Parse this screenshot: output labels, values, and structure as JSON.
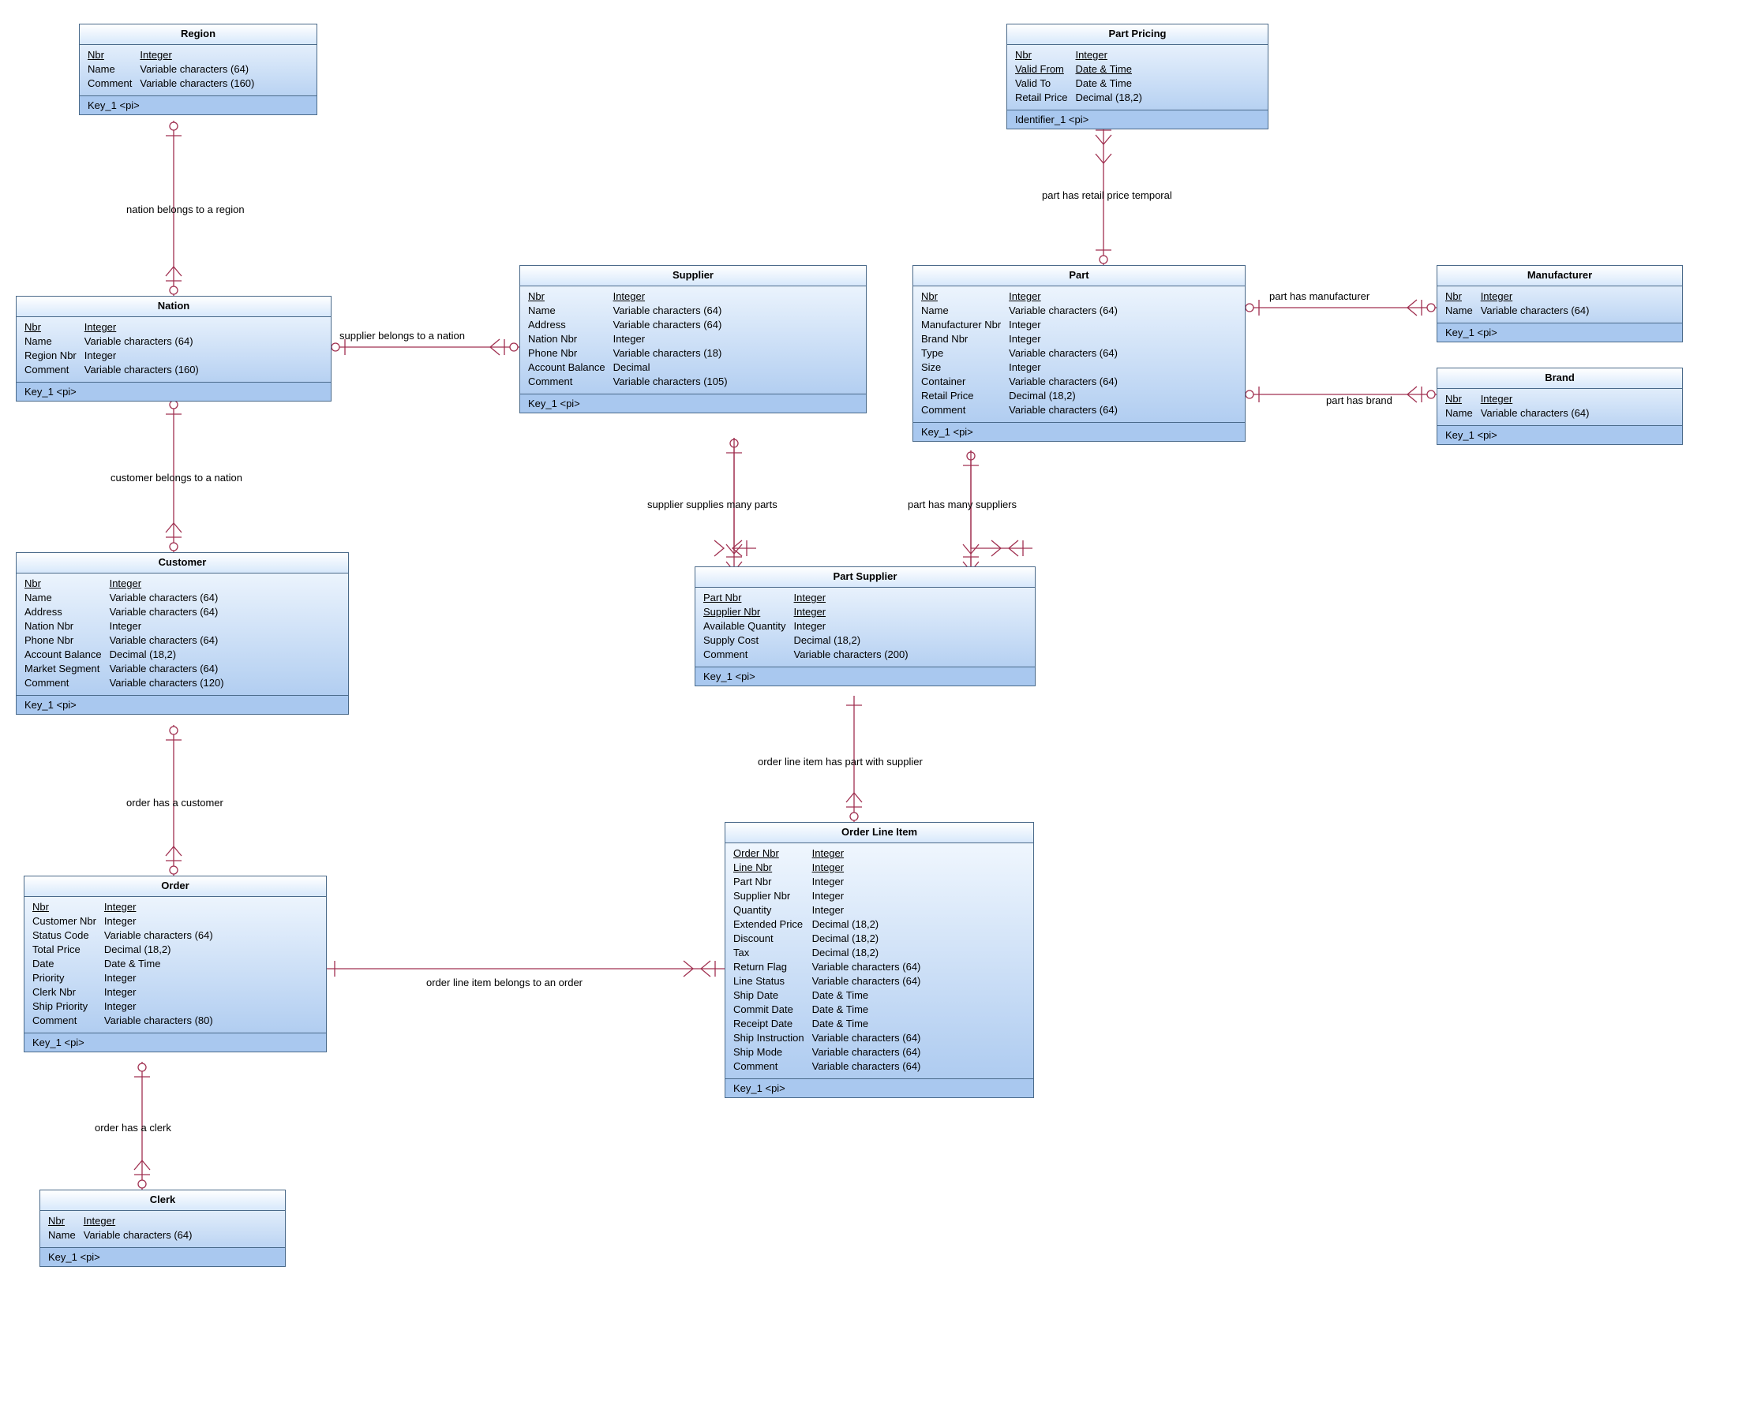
{
  "entities": {
    "region": {
      "title": "Region",
      "attrs": [
        {
          "n": "Nbr",
          "t": "Integer",
          "pk": true
        },
        {
          "n": "Name",
          "t": "Variable characters (64)"
        },
        {
          "n": "Comment",
          "t": "Variable characters (160)"
        }
      ],
      "key": "Key_1   <pi>"
    },
    "nation": {
      "title": "Nation",
      "attrs": [
        {
          "n": "Nbr",
          "t": "Integer",
          "pk": true
        },
        {
          "n": "Name",
          "t": "Variable characters (64)"
        },
        {
          "n": "Region Nbr",
          "t": "Integer"
        },
        {
          "n": "Comment",
          "t": "Variable characters (160)"
        }
      ],
      "key": "Key_1   <pi>"
    },
    "supplier": {
      "title": "Supplier",
      "attrs": [
        {
          "n": "Nbr",
          "t": "Integer",
          "pk": true
        },
        {
          "n": "Name",
          "t": "Variable characters (64)"
        },
        {
          "n": "Address",
          "t": "Variable characters (64)"
        },
        {
          "n": "Nation Nbr",
          "t": "Integer"
        },
        {
          "n": "Phone Nbr",
          "t": "Variable characters (18)"
        },
        {
          "n": "Account Balance",
          "t": "Decimal"
        },
        {
          "n": "Comment",
          "t": "Variable characters (105)"
        }
      ],
      "key": "Key_1   <pi>"
    },
    "customer": {
      "title": "Customer",
      "attrs": [
        {
          "n": "Nbr",
          "t": "Integer",
          "pk": true
        },
        {
          "n": "Name",
          "t": "Variable characters (64)"
        },
        {
          "n": "Address",
          "t": "Variable characters (64)"
        },
        {
          "n": "Nation Nbr",
          "t": "Integer"
        },
        {
          "n": "Phone Nbr",
          "t": "Variable characters (64)"
        },
        {
          "n": "Account Balance",
          "t": "Decimal (18,2)"
        },
        {
          "n": "Market Segment",
          "t": "Variable characters (64)"
        },
        {
          "n": "Comment",
          "t": "Variable characters (120)"
        }
      ],
      "key": "Key_1   <pi>"
    },
    "order": {
      "title": "Order",
      "attrs": [
        {
          "n": "Nbr",
          "t": "Integer",
          "pk": true
        },
        {
          "n": "Customer Nbr",
          "t": "Integer"
        },
        {
          "n": "Status Code",
          "t": "Variable characters (64)"
        },
        {
          "n": "Total Price",
          "t": "Decimal (18,2)"
        },
        {
          "n": "Date",
          "t": "Date & Time"
        },
        {
          "n": "Priority",
          "t": "Integer"
        },
        {
          "n": "Clerk Nbr",
          "t": "Integer"
        },
        {
          "n": "Ship Priority",
          "t": "Integer"
        },
        {
          "n": "Comment",
          "t": "Variable characters (80)"
        }
      ],
      "key": "Key_1   <pi>"
    },
    "clerk": {
      "title": "Clerk",
      "attrs": [
        {
          "n": "Nbr",
          "t": "Integer",
          "pk": true
        },
        {
          "n": "Name",
          "t": "Variable characters (64)"
        }
      ],
      "key": "Key_1   <pi>"
    },
    "partpricing": {
      "title": "Part Pricing",
      "attrs": [
        {
          "n": "Nbr",
          "t": "Integer",
          "pk": true
        },
        {
          "n": "Valid From",
          "t": "Date & Time",
          "pk": true
        },
        {
          "n": "Valid To",
          "t": "Date & Time"
        },
        {
          "n": "Retail Price",
          "t": "Decimal (18,2)"
        }
      ],
      "key": "Identifier_1   <pi>"
    },
    "part": {
      "title": "Part",
      "attrs": [
        {
          "n": "Nbr",
          "t": "Integer",
          "pk": true
        },
        {
          "n": "Name",
          "t": "Variable characters (64)"
        },
        {
          "n": "Manufacturer Nbr",
          "t": "Integer"
        },
        {
          "n": "Brand Nbr",
          "t": "Integer"
        },
        {
          "n": "Type",
          "t": "Variable characters (64)"
        },
        {
          "n": "Size",
          "t": "Integer"
        },
        {
          "n": "Container",
          "t": "Variable characters (64)"
        },
        {
          "n": "Retail Price",
          "t": "Decimal (18,2)"
        },
        {
          "n": "Comment",
          "t": "Variable characters (64)"
        }
      ],
      "key": "Key_1   <pi>"
    },
    "manufacturer": {
      "title": "Manufacturer",
      "attrs": [
        {
          "n": "Nbr",
          "t": "Integer",
          "pk": true
        },
        {
          "n": "Name",
          "t": "Variable characters (64)"
        }
      ],
      "key": "Key_1   <pi>"
    },
    "brand": {
      "title": "Brand",
      "attrs": [
        {
          "n": "Nbr",
          "t": "Integer",
          "pk": true
        },
        {
          "n": "Name",
          "t": "Variable characters (64)"
        }
      ],
      "key": "Key_1   <pi>"
    },
    "partsupplier": {
      "title": "Part Supplier",
      "attrs": [
        {
          "n": "Part Nbr",
          "t": "Integer",
          "pk": true
        },
        {
          "n": "Supplier Nbr",
          "t": "Integer",
          "pk": true
        },
        {
          "n": "Available Quantity",
          "t": "Integer"
        },
        {
          "n": "Supply Cost",
          "t": "Decimal (18,2)"
        },
        {
          "n": "Comment",
          "t": "Variable characters (200)"
        }
      ],
      "key": "Key_1   <pi>"
    },
    "orderlineitem": {
      "title": "Order Line Item",
      "attrs": [
        {
          "n": "Order Nbr",
          "t": "Integer",
          "pk": true
        },
        {
          "n": "Line Nbr",
          "t": "Integer",
          "pk": true
        },
        {
          "n": "Part Nbr",
          "t": "Integer"
        },
        {
          "n": "Supplier Nbr",
          "t": "Integer"
        },
        {
          "n": "Quantity",
          "t": "Integer"
        },
        {
          "n": "Extended Price",
          "t": "Decimal (18,2)"
        },
        {
          "n": "Discount",
          "t": "Decimal (18,2)"
        },
        {
          "n": "Tax",
          "t": "Decimal (18,2)"
        },
        {
          "n": "Return Flag",
          "t": "Variable characters (64)"
        },
        {
          "n": "Line Status",
          "t": "Variable characters (64)"
        },
        {
          "n": "Ship Date",
          "t": "Date & Time"
        },
        {
          "n": "Commit Date",
          "t": "Date & Time"
        },
        {
          "n": "Receipt Date",
          "t": "Date & Time"
        },
        {
          "n": "Ship Instruction",
          "t": "Variable characters (64)"
        },
        {
          "n": "Ship Mode",
          "t": "Variable characters (64)"
        },
        {
          "n": "Comment",
          "t": "Variable characters (64)"
        }
      ],
      "key": "Key_1   <pi>"
    }
  },
  "relationships": {
    "region_nation": "nation belongs to a region",
    "nation_customer": "customer belongs to a nation",
    "nation_supplier": "supplier belongs to a nation",
    "customer_order": "order has a customer",
    "order_clerk": "order has a clerk",
    "order_lineitem": "order line item belongs to an order",
    "pricing_part": "part has retail price temporal",
    "part_manufacturer": "part has manufacturer",
    "part_brand": "part has brand",
    "supplier_parts": "supplier supplies many parts",
    "part_suppliers": "part has many suppliers",
    "lineitem_partsupplier": "order line item has part with supplier"
  },
  "chart_data": {
    "type": "table",
    "title": "TPC-H Conceptual Data Model (ER Diagram)",
    "entities": [
      "Region",
      "Nation",
      "Supplier",
      "Customer",
      "Order",
      "Clerk",
      "Part Pricing",
      "Part",
      "Manufacturer",
      "Brand",
      "Part Supplier",
      "Order Line Item"
    ],
    "relationships": [
      {
        "from": "Nation",
        "to": "Region",
        "label": "nation belongs to a region"
      },
      {
        "from": "Customer",
        "to": "Nation",
        "label": "customer belongs to a nation"
      },
      {
        "from": "Supplier",
        "to": "Nation",
        "label": "supplier belongs to a nation"
      },
      {
        "from": "Order",
        "to": "Customer",
        "label": "order has a customer"
      },
      {
        "from": "Order",
        "to": "Clerk",
        "label": "order has a clerk"
      },
      {
        "from": "Order Line Item",
        "to": "Order",
        "label": "order line item belongs to an order"
      },
      {
        "from": "Part Pricing",
        "to": "Part",
        "label": "part has retail price temporal"
      },
      {
        "from": "Part",
        "to": "Manufacturer",
        "label": "part has manufacturer"
      },
      {
        "from": "Part",
        "to": "Brand",
        "label": "part has brand"
      },
      {
        "from": "Part Supplier",
        "to": "Supplier",
        "label": "supplier supplies many parts"
      },
      {
        "from": "Part Supplier",
        "to": "Part",
        "label": "part has many suppliers"
      },
      {
        "from": "Order Line Item",
        "to": "Part Supplier",
        "label": "order line item has part with supplier"
      }
    ]
  }
}
